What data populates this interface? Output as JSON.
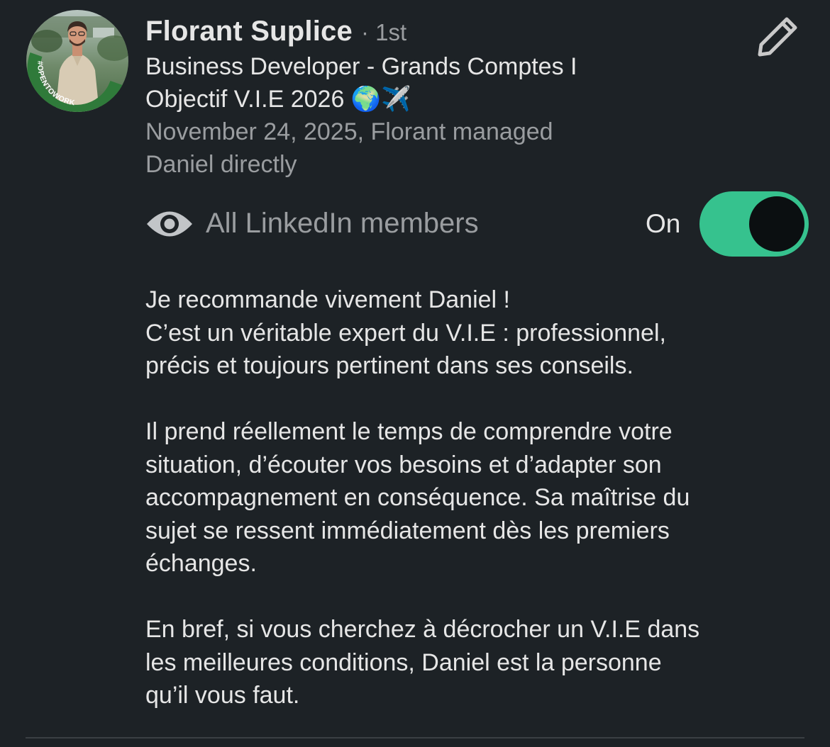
{
  "recommender": {
    "name": "Florant Suplice",
    "degree": "· 1st",
    "headline": "Business Developer - Grands Comptes I\nObjectif V.I.E 2026 🌍✈️",
    "relationship": "November 24, 2025, Florant managed\nDaniel directly",
    "avatar_badge": "#OPENTOWORK"
  },
  "visibility": {
    "label": "All LinkedIn members",
    "toggle_state_label": "On",
    "toggle_on": true
  },
  "recommendation": {
    "paragraphs": [
      "Je recommande vivement Daniel !\nC’est un véritable expert du V.I.E : professionnel,\nprécis et toujours pertinent dans ses conseils.",
      "Il prend réellement le temps de comprendre votre\nsituation, d’écouter vos besoins et d’adapter son\naccompagnement en conséquence. Sa maîtrise du\nsujet se ressent immédiatement dès les premiers\néchanges.",
      "En bref, si vous cherchez à décrocher un V.I.E dans\nles meilleures conditions, Daniel est la personne\nqu’il vous faut."
    ]
  },
  "icons": {
    "edit": "pencil-icon",
    "visibility": "eye-icon"
  },
  "colors": {
    "background": "#1d2226",
    "toggle_on": "#36c28e",
    "open_to_work_ring": "#2f7a3a",
    "text_primary": "#e6e6e6",
    "text_secondary": "#9a9da0"
  }
}
